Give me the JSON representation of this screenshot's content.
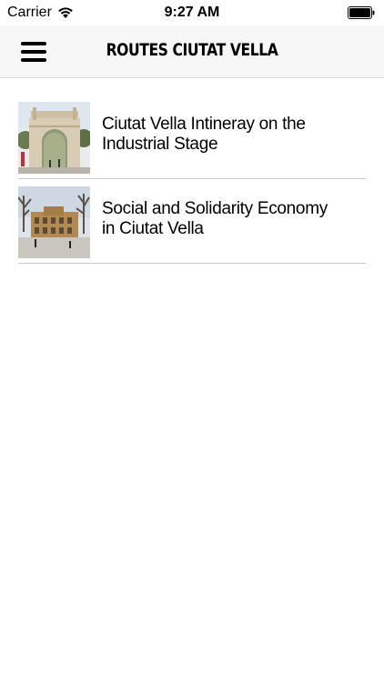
{
  "status_bar": {
    "carrier": "Carrier",
    "time": "9:27 AM"
  },
  "nav": {
    "title": "Routes Ciutat Vella",
    "menu_icon": "hamburger-menu-icon"
  },
  "routes": [
    {
      "title": "Ciutat Vella Intineray on the Industrial Stage",
      "thumbnail": "gate-archway-photo"
    },
    {
      "title": "Social and Solidarity Economy in Ciutat Vella",
      "thumbnail": "square-building-photo"
    }
  ],
  "colors": {
    "nav_background": "#f7f7f7",
    "divider": "#c8c8c8",
    "text": "#000000"
  }
}
